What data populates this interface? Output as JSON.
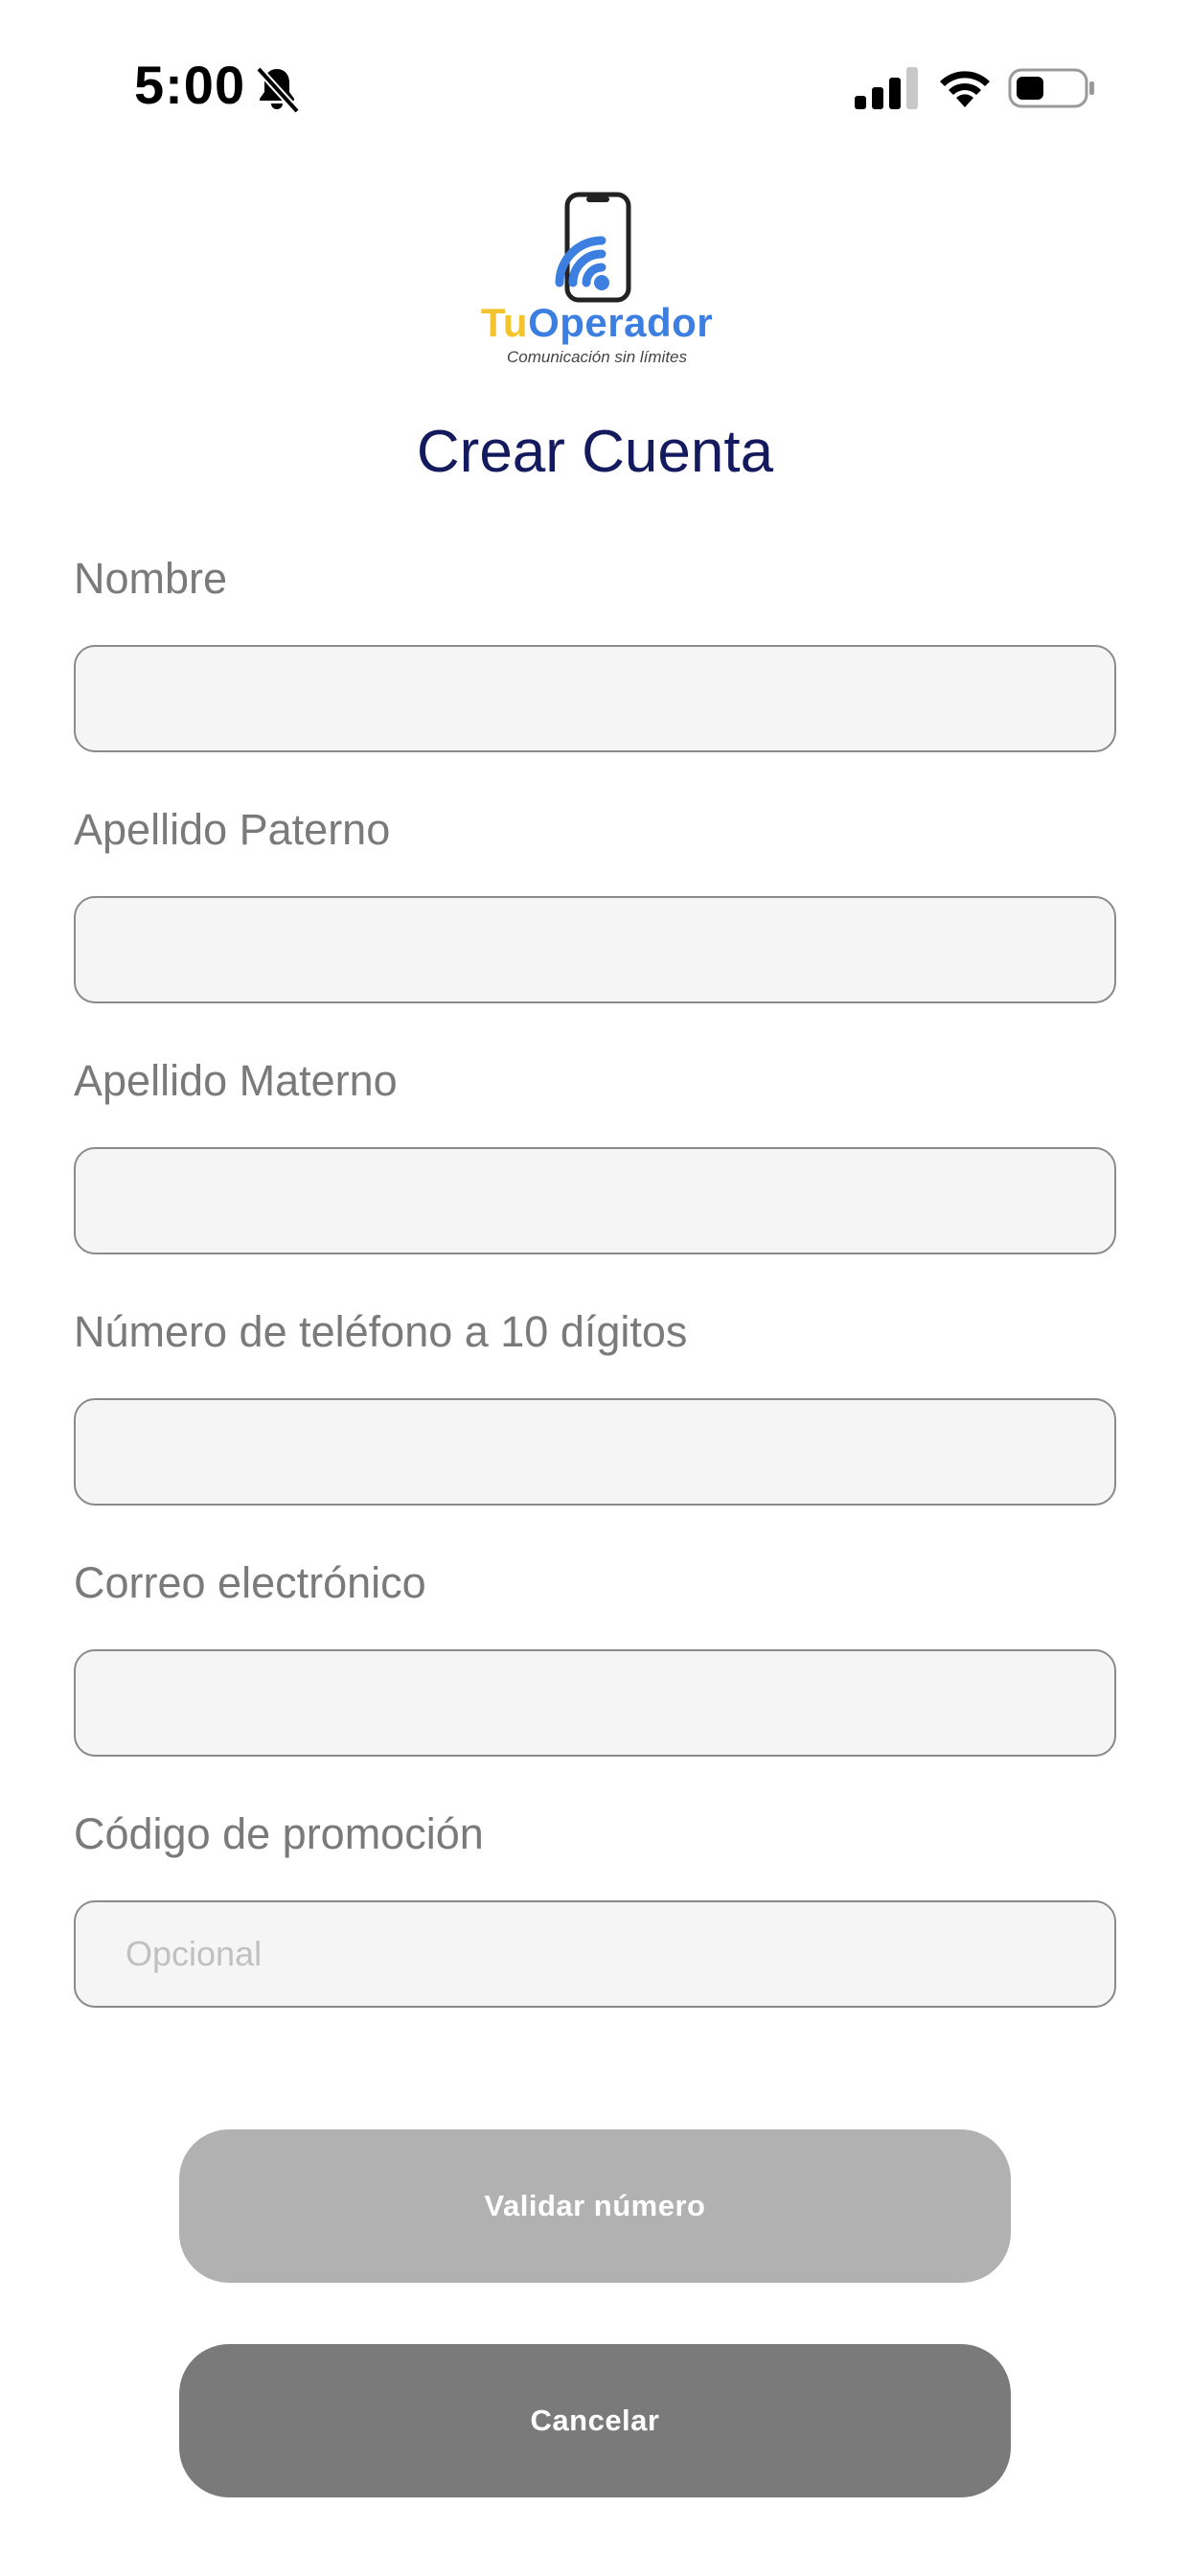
{
  "status_bar": {
    "time": "5:00",
    "icons": [
      "bell-slash-icon",
      "cellular-signal-icon",
      "wifi-icon",
      "battery-icon"
    ]
  },
  "logo": {
    "brand_part1": "Tu",
    "brand_part2": "Operador",
    "tagline": "Comunicación sin límites",
    "colors": {
      "tu": "#f4c430",
      "operador": "#3d7fe0"
    }
  },
  "title": "Crear Cuenta",
  "form": {
    "fields": [
      {
        "label": "Nombre",
        "value": "",
        "placeholder": ""
      },
      {
        "label": "Apellido Paterno",
        "value": "",
        "placeholder": ""
      },
      {
        "label": "Apellido Materno",
        "value": "",
        "placeholder": ""
      },
      {
        "label": "Número de teléfono a 10 dígitos",
        "value": "",
        "placeholder": ""
      },
      {
        "label": "Correo electrónico",
        "value": "",
        "placeholder": ""
      },
      {
        "label": "Código de promoción",
        "value": "",
        "placeholder": "Opcional"
      }
    ]
  },
  "buttons": {
    "validate": "Validar número",
    "cancel": "Cancelar"
  },
  "colors": {
    "title": "#141a5e",
    "validate_button": "#b1b1b1",
    "cancel_button": "#7a7a7a"
  }
}
